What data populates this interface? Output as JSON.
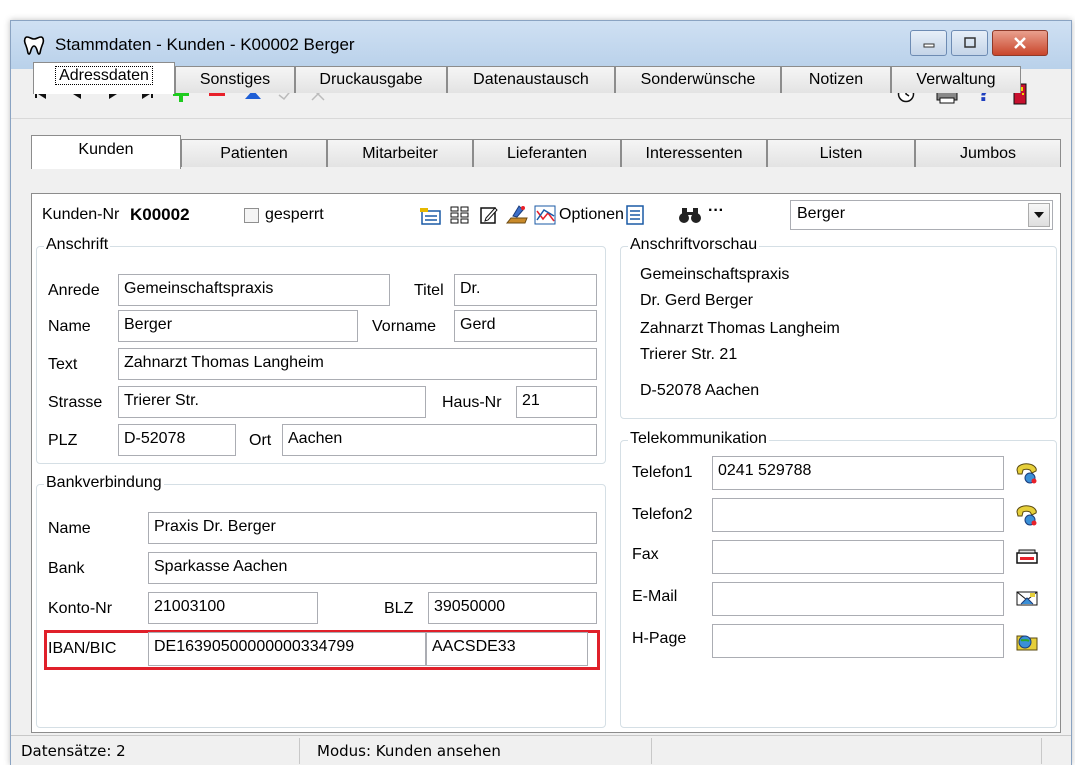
{
  "window": {
    "title": "Stammdaten - Kunden - K00002 Berger"
  },
  "main_tabs": [
    {
      "label": "Kunden",
      "active": true
    },
    {
      "label": "Patienten"
    },
    {
      "label": "Mitarbeiter"
    },
    {
      "label": "Lieferanten"
    },
    {
      "label": "Interessenten"
    },
    {
      "label": "Listen"
    },
    {
      "label": "Jumbos"
    }
  ],
  "sub_tabs": [
    {
      "label": "Adressdaten",
      "active": true
    },
    {
      "label": "Sonstiges"
    },
    {
      "label": "Druckausgabe"
    },
    {
      "label": "Datenaustausch"
    },
    {
      "label": "Sonderwünsche"
    },
    {
      "label": "Notizen"
    },
    {
      "label": "Verwaltung"
    }
  ],
  "header": {
    "kunden_nr_label": "Kunden-Nr",
    "kunden_nr_value": "K00002",
    "gesperrt_label": "gesperrt",
    "gesperrt_checked": false,
    "optionen_label": "Optionen",
    "search_dots": "···",
    "select_value": "Berger"
  },
  "anschrift": {
    "title": "Anschrift",
    "anrede_label": "Anrede",
    "anrede_value": "Gemeinschaftspraxis",
    "titel_label": "Titel",
    "titel_value": "Dr.",
    "name_label": "Name",
    "name_value": "Berger",
    "vorname_label": "Vorname",
    "vorname_value": "Gerd",
    "text_label": "Text",
    "text_value": "Zahnarzt Thomas Langheim",
    "strasse_label": "Strasse",
    "strasse_value": "Trierer Str.",
    "hausnr_label": "Haus-Nr",
    "hausnr_value": "21",
    "plz_label": "PLZ",
    "plz_value": "D-52078",
    "ort_label": "Ort",
    "ort_value": "Aachen"
  },
  "bank": {
    "title": "Bankverbindung",
    "name_label": "Name",
    "name_value": "Praxis Dr. Berger",
    "bank_label": "Bank",
    "bank_value": "Sparkasse Aachen",
    "konto_label": "Konto-Nr",
    "konto_value": "21003100",
    "blz_label": "BLZ",
    "blz_value": "39050000",
    "iban_label": "IBAN/BIC",
    "iban_value": "DE16390500000000334799",
    "bic_value": "AACSDE33",
    "highlight_color": "#e0202a"
  },
  "vorschau": {
    "title": "Anschriftvorschau",
    "lines": [
      "Gemeinschaftspraxis",
      "Dr. Gerd Berger",
      "Zahnarzt Thomas Langheim",
      "Trierer Str. 21",
      "D-52078 Aachen"
    ]
  },
  "telekom": {
    "title": "Telekommunikation",
    "telefon1_label": "Telefon1",
    "telefon1_value": "0241 529788",
    "telefon2_label": "Telefon2",
    "telefon2_value": "",
    "fax_label": "Fax",
    "fax_value": "",
    "email_label": "E-Mail",
    "email_value": "",
    "hpage_label": "H-Page",
    "hpage_value": ""
  },
  "status": {
    "records": "Datensätze: 2",
    "mode": "Modus:  Kunden ansehen"
  },
  "icons": [
    "tooth-icon",
    "first-record-icon",
    "prev-record-icon",
    "next-record-icon",
    "last-record-icon",
    "add-icon",
    "delete-icon",
    "edit-icon",
    "save-icon",
    "cancel-icon",
    "clock-icon",
    "printer-icon",
    "help-icon",
    "exit-door-icon",
    "binoculars-icon",
    "phone-icon",
    "fax-icon",
    "email-icon",
    "web-icon"
  ]
}
